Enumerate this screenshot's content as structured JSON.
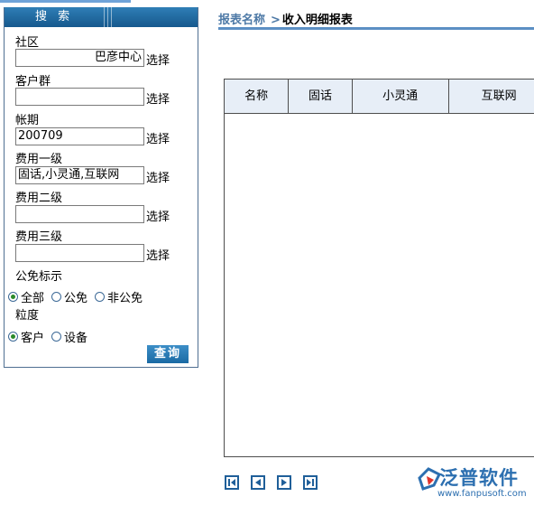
{
  "search": {
    "header": "搜 索",
    "select_label": "选择",
    "fields": [
      {
        "label": "社区",
        "value": "巴彦中心"
      },
      {
        "label": "客户群",
        "value": ""
      },
      {
        "label": "帐期",
        "value": "200709"
      },
      {
        "label": "费用一级",
        "value": "固话,小灵通,互联网"
      },
      {
        "label": "费用二级",
        "value": ""
      },
      {
        "label": "费用三级",
        "value": ""
      }
    ],
    "exempt": {
      "label": "公免标示",
      "options": [
        "全部",
        "公免",
        "非公免"
      ],
      "selected": "全部"
    },
    "granularity": {
      "label": "粒度",
      "options": [
        "客户",
        "设备"
      ],
      "selected": "客户"
    },
    "query_button": "查询"
  },
  "report": {
    "title_key": "报表名称",
    "title_sep": ">",
    "title_value": "收入明细报表",
    "columns": [
      "名称",
      "固话",
      "小灵通",
      "互联网"
    ]
  },
  "pager": {
    "buttons": [
      "first-page",
      "prev-page",
      "next-page",
      "last-page"
    ]
  },
  "logo": {
    "name": "泛普软件",
    "url": "www.fanpusoft.com"
  },
  "colors": {
    "accent": "#2f7eb6",
    "grid_header_bg": "#e7eef7",
    "title_rule": "#5c8fc4"
  }
}
